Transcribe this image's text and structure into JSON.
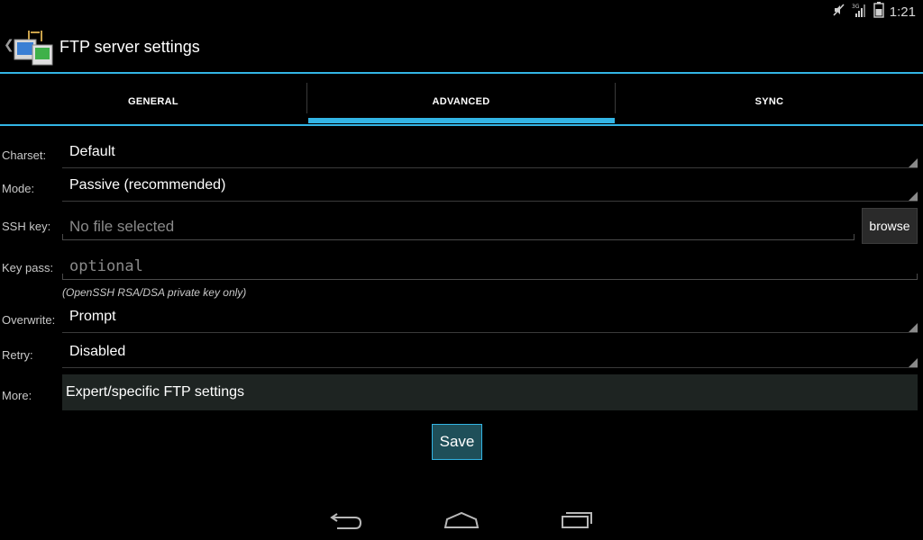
{
  "status_bar": {
    "time": "1:21",
    "icons": [
      "mute-icon",
      "signal-3g-icon",
      "battery-icon"
    ]
  },
  "action_bar": {
    "title": "FTP server settings"
  },
  "tabs": [
    {
      "label": "GENERAL",
      "selected": false
    },
    {
      "label": "ADVANCED",
      "selected": true
    },
    {
      "label": "SYNC",
      "selected": false
    }
  ],
  "form": {
    "charset": {
      "label": "Charset:",
      "value": "Default"
    },
    "mode": {
      "label": "Mode:",
      "value": "Passive (recommended)"
    },
    "ssh_key": {
      "label": "SSH key:",
      "placeholder": "No file selected",
      "browse_label": "browse"
    },
    "key_pass": {
      "label": "Key pass:",
      "placeholder": "optional",
      "hint": "(OpenSSH RSA/DSA private key only)"
    },
    "overwrite": {
      "label": "Overwrite:",
      "value": "Prompt"
    },
    "retry": {
      "label": "Retry:",
      "value": "Disabled"
    },
    "more": {
      "label": "More:",
      "button_label": "Expert/specific FTP settings"
    }
  },
  "save_label": "Save",
  "colors": {
    "accent": "#33b5e5",
    "background": "#000000",
    "save_fill": "#1f4f59"
  }
}
